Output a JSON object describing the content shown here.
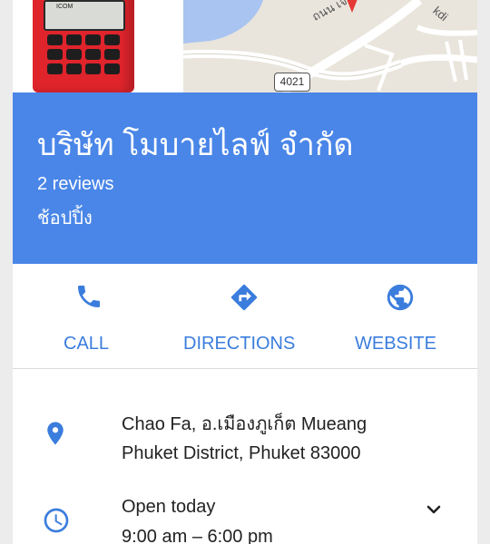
{
  "photos": {
    "radio_brand": "ICOM",
    "map_road_label": "ถนน เจ้าฟ้าตะวัน",
    "map_street_label": "kdi",
    "map_route_shield": "4021"
  },
  "header": {
    "business_name": "บริษัท โมบายไลฟ์ จำกัด",
    "reviews": "2 reviews",
    "category": "ช้อปปิ้ง"
  },
  "actions": [
    {
      "label": "CALL",
      "icon": "phone-icon"
    },
    {
      "label": "DIRECTIONS",
      "icon": "directions-icon"
    },
    {
      "label": "WEBSITE",
      "icon": "globe-icon"
    }
  ],
  "info": {
    "address_line1": "Chao Fa, อ.เมืองภูเก็ต Mueang",
    "address_line2": "Phuket District, Phuket 83000",
    "hours_title": "Open today",
    "hours_range": "9:00 am – 6:00 pm"
  },
  "colors": {
    "header_bg": "#4a86e8",
    "accent": "#3b7ddd",
    "page_bg": "#ececec"
  }
}
